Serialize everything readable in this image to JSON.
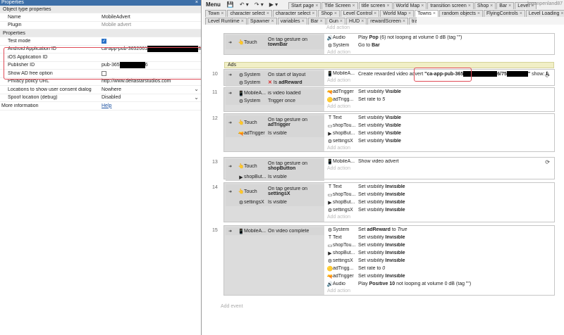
{
  "properties": {
    "title": "Properties",
    "close": "×",
    "rows": [
      {
        "k": "Object type properties",
        "v": "",
        "cls": "sec top"
      },
      {
        "k": "Name",
        "v": "MobileAdvert",
        "cls": ""
      },
      {
        "k": "Plugin",
        "v": "Mobile advert",
        "cls": "",
        "grey": true
      },
      {
        "k": "Properties",
        "v": "",
        "cls": "sec top"
      },
      {
        "k": "Test mode",
        "v": "",
        "cb": "on"
      },
      {
        "k": "Android Application ID",
        "v": "ca-app-pub-3652061",
        "redact": true,
        "tail": "8"
      },
      {
        "k": "iOS Application ID",
        "v": ""
      },
      {
        "k": "Publisher ID",
        "v": "pub-365",
        "redact": true,
        "tail": "6"
      },
      {
        "k": "Show AD free option",
        "v": "",
        "cb": "off"
      },
      {
        "k": "Privacy policy URL",
        "v": "http://www.deltastarstudios.com"
      },
      {
        "k": "Locations to show user consent dialog",
        "v": "Nowhere",
        "select": true
      },
      {
        "k": "Spoof location (debug)",
        "v": "Disabled",
        "select": true
      },
      {
        "k": "More information",
        "v": "Help",
        "link": true,
        "top": true
      }
    ]
  },
  "toolbar": {
    "menu": "Menu",
    "save": "💾",
    "undo": "↶ ▾",
    "redo": "↷ ▾",
    "play": "▶ ▾",
    "user": "loganpenland87"
  },
  "tabs_row1": [
    {
      "l": "Town",
      "on": false
    },
    {
      "l": "character select",
      "on": false
    },
    {
      "l": "character select",
      "on": false
    },
    {
      "l": "Shop",
      "on": false
    },
    {
      "l": "Level Control",
      "on": false
    },
    {
      "l": "World Map",
      "on": false
    },
    {
      "l": "Towns",
      "on": true
    },
    {
      "l": "random objects",
      "on": false
    },
    {
      "l": "FlyingControls",
      "on": false
    },
    {
      "l": "Level Loading",
      "on": false
    }
  ],
  "tabs_top": [
    {
      "l": "Start page"
    },
    {
      "l": "Title Screen"
    },
    {
      "l": "title screen"
    },
    {
      "l": "World Map"
    },
    {
      "l": "transition screen"
    },
    {
      "l": "Shop"
    },
    {
      "l": "Bar"
    },
    {
      "l": "Level"
    }
  ],
  "tabs_row2": [
    {
      "l": "Level Runtime"
    },
    {
      "l": "Spawner"
    },
    {
      "l": "variables"
    },
    {
      "l": "Bar"
    },
    {
      "l": "Gun"
    },
    {
      "l": "HUD"
    },
    {
      "l": "rewardScreen"
    },
    {
      "l": "transition screen"
    }
  ],
  "events": {
    "add_action": "Add action",
    "add_event": "Add event",
    "e0": {
      "cond": [
        {
          "icon": "👆",
          "obj": "Touch",
          "txt": "On tap gesture on",
          "obj2": "townBar"
        }
      ],
      "acts": [
        {
          "icon": "🔊",
          "obj": "Audio",
          "txt": "Play ",
          "b": "Pop",
          "t2": " (6) not looping at volume 0 dB (tag \"\")"
        },
        {
          "icon": "⚙",
          "obj": "System",
          "txt": "Go to ",
          "b": "Bar"
        }
      ]
    },
    "group": "Ads",
    "e10": {
      "num": "10",
      "cond": [
        {
          "icon": "⚙",
          "obj": "System",
          "txt": "On start of layout"
        },
        {
          "icon": "⚙",
          "obj": "System",
          "txt": "Is ",
          "b": "adReward",
          "x": "✕"
        }
      ],
      "acts": [
        {
          "icon": "📱",
          "obj": "MobileA...",
          "txt": "Create rewarded video advert ",
          "b": "\"ca-app-pub-365",
          "b2": "6/75",
          "b3": "\"",
          "t2": " show: ",
          "b4": "false"
        }
      ]
    },
    "e11": {
      "num": "11",
      "cond": [
        {
          "icon": "📱",
          "obj": "MobileA...",
          "txt": "is video loaded"
        },
        {
          "icon": "⚙",
          "obj": "System",
          "txt": "Trigger once"
        }
      ],
      "acts": [
        {
          "icon": "🔫",
          "obj": "adTrigger",
          "txt": "Set visibility ",
          "b": "Visible"
        },
        {
          "icon": "🟡",
          "obj": "adTrigg...",
          "txt": "Set rate to ",
          "i": "5"
        }
      ]
    },
    "e12": {
      "num": "12",
      "cond": [
        {
          "icon": "👆",
          "obj": "Touch",
          "txt": "On tap gesture on",
          "obj2": "adTrigger"
        },
        {
          "icon": "🔫",
          "obj": "adTrigger",
          "txt": "Is visible"
        }
      ],
      "acts": [
        {
          "icon": "T",
          "obj": "Text",
          "txt": "Set visibility ",
          "b": "Visible"
        },
        {
          "icon": "▭",
          "obj": "shopTou...",
          "txt": "Set visibility ",
          "b": "Visible"
        },
        {
          "icon": "▶",
          "obj": "shopBut...",
          "txt": "Set visibility ",
          "b": "Visible"
        },
        {
          "icon": "⚙",
          "obj": "settingsX",
          "txt": "Set visibility ",
          "b": "Visible"
        }
      ]
    },
    "e13": {
      "num": "13",
      "cond": [
        {
          "icon": "👆",
          "obj": "Touch",
          "txt": "On tap gesture on",
          "obj2": "shopButton"
        },
        {
          "icon": "▶",
          "obj": "shopBut...",
          "txt": "Is visible"
        }
      ],
      "acts": [
        {
          "icon": "📱",
          "obj": "MobileA...",
          "txt": "Show video advert"
        }
      ]
    },
    "e14": {
      "num": "14",
      "cond": [
        {
          "icon": "👆",
          "obj": "Touch",
          "txt": "On tap gesture on",
          "obj2": "settingsX"
        },
        {
          "icon": "⚙",
          "obj": "settingsX",
          "txt": "Is visible"
        }
      ],
      "acts": [
        {
          "icon": "T",
          "obj": "Text",
          "txt": "Set visibility ",
          "b": "Invisible"
        },
        {
          "icon": "▭",
          "obj": "shopTou...",
          "txt": "Set visibility ",
          "b": "Invisible"
        },
        {
          "icon": "▶",
          "obj": "shopBut...",
          "txt": "Set visibility ",
          "b": "Invisible"
        },
        {
          "icon": "⚙",
          "obj": "settingsX",
          "txt": "Set visibility ",
          "b": "Invisible"
        }
      ]
    },
    "e15": {
      "num": "15",
      "cond": [
        {
          "icon": "📱",
          "obj": "MobileA...",
          "txt": "On video complete"
        }
      ],
      "acts": [
        {
          "icon": "⚙",
          "obj": "System",
          "txt": "Set ",
          "b": "adReward",
          "t2": " to ",
          "i": "True"
        },
        {
          "icon": "T",
          "obj": "Text",
          "txt": "Set visibility ",
          "b": "Invisible"
        },
        {
          "icon": "▭",
          "obj": "shopTou...",
          "txt": "Set visibility ",
          "b": "Invisible"
        },
        {
          "icon": "▶",
          "obj": "shopBut...",
          "txt": "Set visibility ",
          "b": "Invisible"
        },
        {
          "icon": "⚙",
          "obj": "settingsX",
          "txt": "Set visibility ",
          "b": "Invisible"
        },
        {
          "icon": "🟡",
          "obj": "adTrigg...",
          "txt": "Set rate to ",
          "i": "0"
        },
        {
          "icon": "🔫",
          "obj": "adTrigger",
          "txt": "Set visibility ",
          "b": "Invisible"
        },
        {
          "icon": "🔊",
          "obj": "Audio",
          "txt": "Play ",
          "b": "Positive 10",
          "t2": " not looping at volume 0 dB (tag \"\")"
        }
      ]
    }
  }
}
